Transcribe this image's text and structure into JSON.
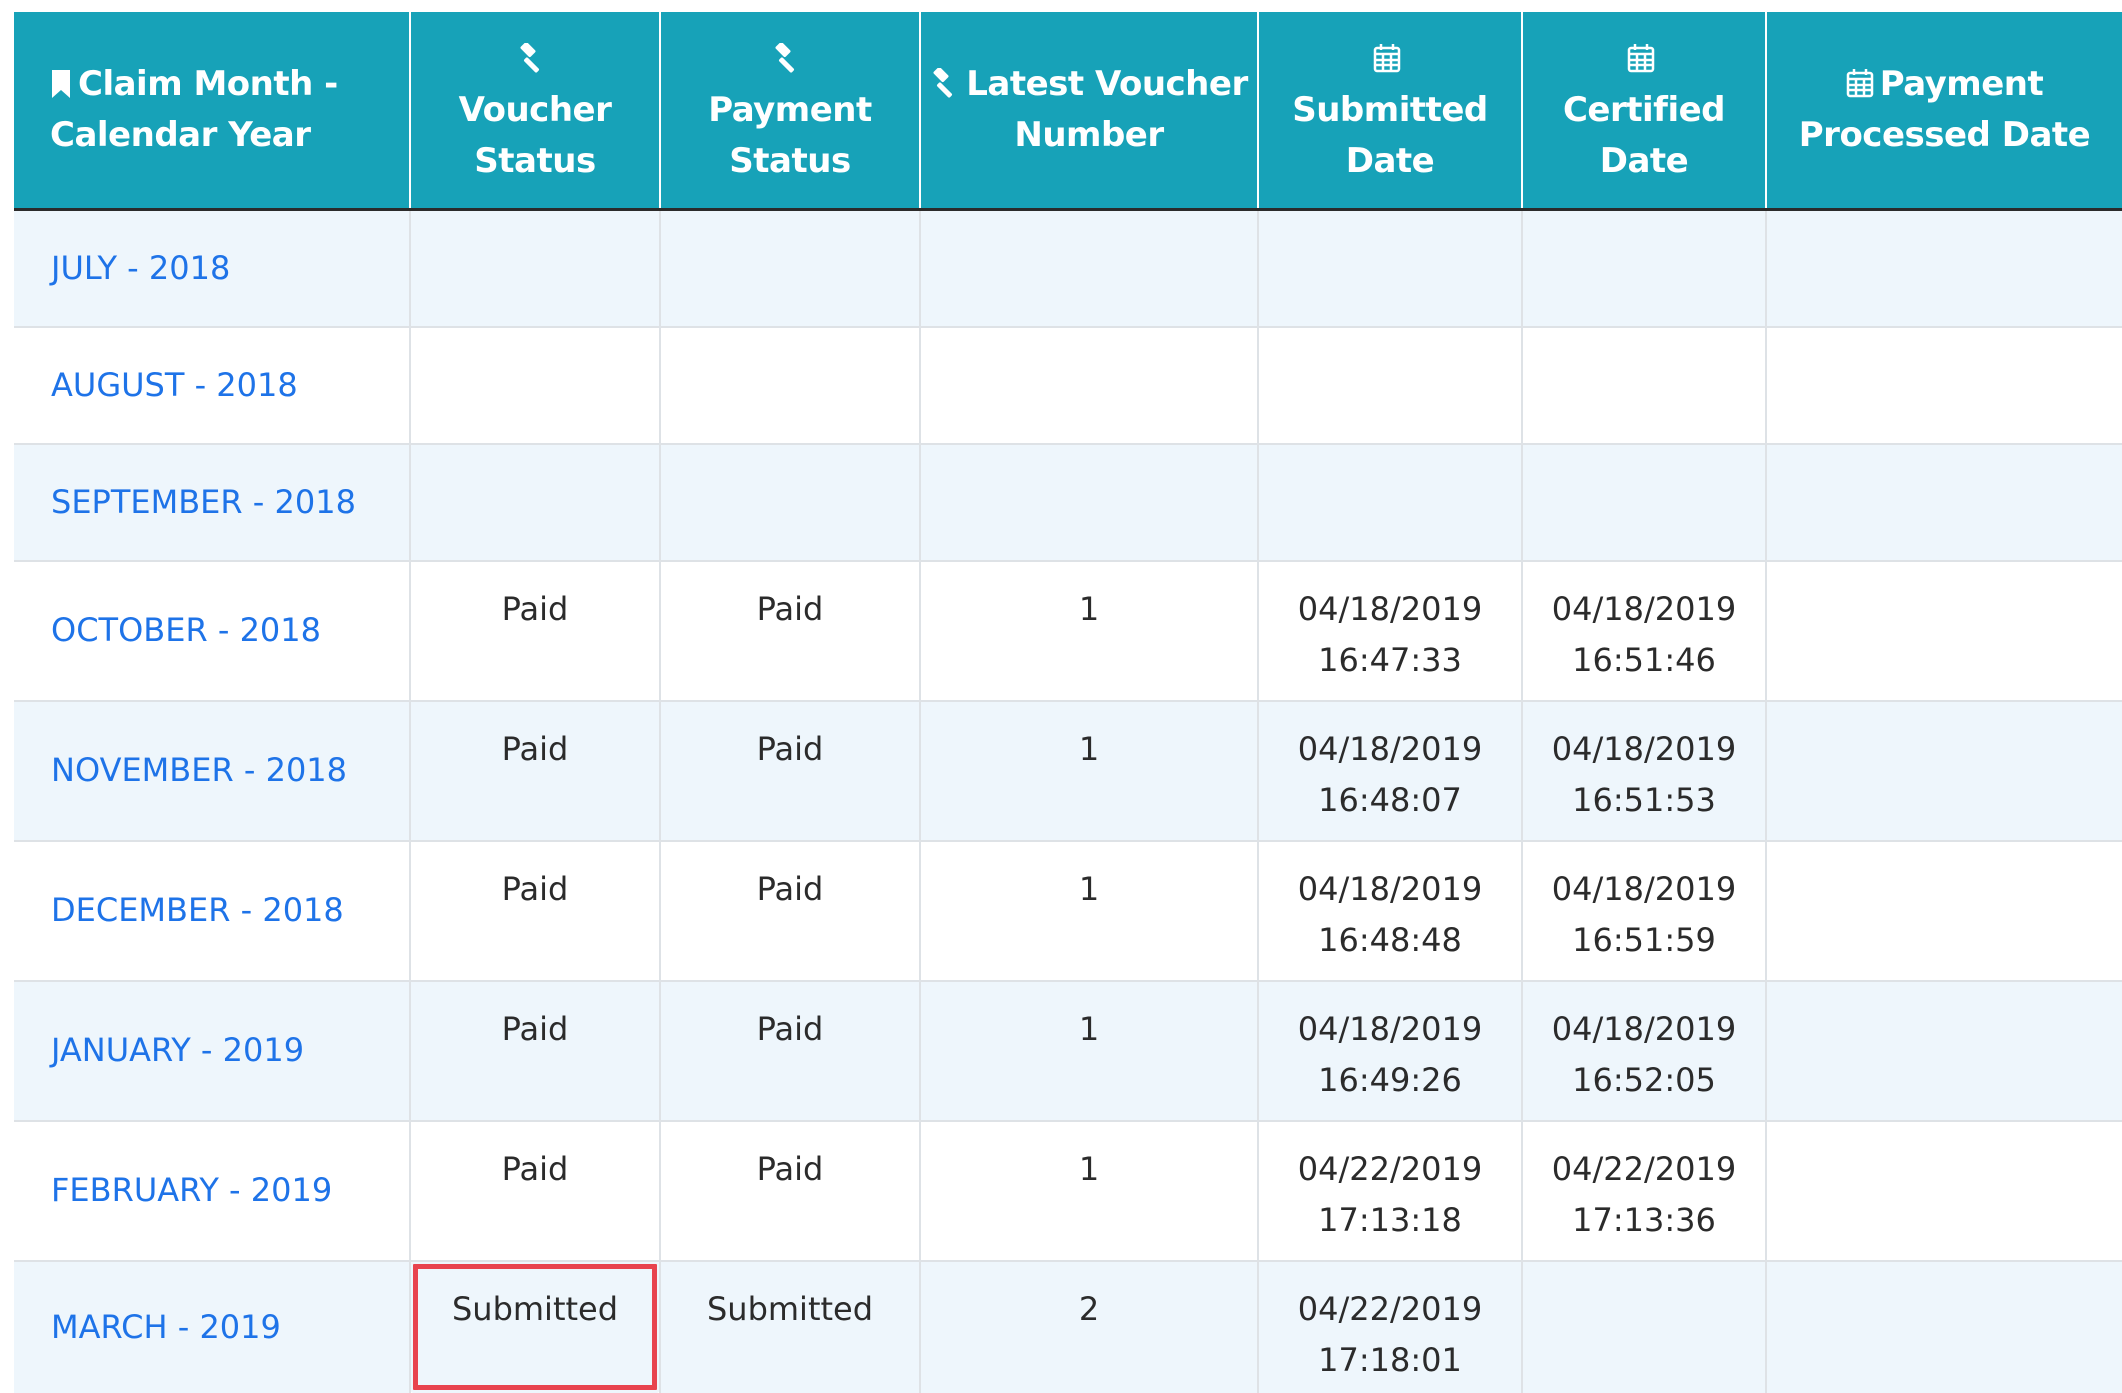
{
  "table": {
    "headers": [
      {
        "icon": "bookmark-icon",
        "label": "Claim Month - Calendar Year"
      },
      {
        "icon": "gavel-icon",
        "label": "Voucher Status"
      },
      {
        "icon": "gavel-icon",
        "label": "Payment Status"
      },
      {
        "icon": "gavel-icon",
        "label": "Latest Voucher Number"
      },
      {
        "icon": "calendar-icon",
        "label": "Submitted Date"
      },
      {
        "icon": "calendar-icon",
        "label": "Certified Date"
      },
      {
        "icon": "calendar-icon",
        "label": "Payment Processed Date"
      }
    ],
    "rows": [
      {
        "month": "JULY - 2018",
        "voucher_status": "",
        "payment_status": "",
        "voucher_number": "",
        "submitted_date": "",
        "submitted_time": "",
        "certified_date": "",
        "certified_time": "",
        "processed_date": ""
      },
      {
        "month": "AUGUST - 2018",
        "voucher_status": "",
        "payment_status": "",
        "voucher_number": "",
        "submitted_date": "",
        "submitted_time": "",
        "certified_date": "",
        "certified_time": "",
        "processed_date": ""
      },
      {
        "month": "SEPTEMBER - 2018",
        "voucher_status": "",
        "payment_status": "",
        "voucher_number": "",
        "submitted_date": "",
        "submitted_time": "",
        "certified_date": "",
        "certified_time": "",
        "processed_date": ""
      },
      {
        "month": "OCTOBER - 2018",
        "voucher_status": "Paid",
        "payment_status": "Paid",
        "voucher_number": "1",
        "submitted_date": "04/18/2019",
        "submitted_time": "16:47:33",
        "certified_date": "04/18/2019",
        "certified_time": "16:51:46",
        "processed_date": ""
      },
      {
        "month": "NOVEMBER - 2018",
        "voucher_status": "Paid",
        "payment_status": "Paid",
        "voucher_number": "1",
        "submitted_date": "04/18/2019",
        "submitted_time": "16:48:07",
        "certified_date": "04/18/2019",
        "certified_time": "16:51:53",
        "processed_date": ""
      },
      {
        "month": "DECEMBER - 2018",
        "voucher_status": "Paid",
        "payment_status": "Paid",
        "voucher_number": "1",
        "submitted_date": "04/18/2019",
        "submitted_time": "16:48:48",
        "certified_date": "04/18/2019",
        "certified_time": "16:51:59",
        "processed_date": ""
      },
      {
        "month": "JANUARY - 2019",
        "voucher_status": "Paid",
        "payment_status": "Paid",
        "voucher_number": "1",
        "submitted_date": "04/18/2019",
        "submitted_time": "16:49:26",
        "certified_date": "04/18/2019",
        "certified_time": "16:52:05",
        "processed_date": ""
      },
      {
        "month": "FEBRUARY - 2019",
        "voucher_status": "Paid",
        "payment_status": "Paid",
        "voucher_number": "1",
        "submitted_date": "04/22/2019",
        "submitted_time": "17:13:18",
        "certified_date": "04/22/2019",
        "certified_time": "17:13:36",
        "processed_date": ""
      },
      {
        "month": "MARCH - 2019",
        "voucher_status": "Submitted",
        "payment_status": "Submitted",
        "voucher_number": "2",
        "submitted_date": "04/22/2019",
        "submitted_time": "17:18:01",
        "certified_date": "",
        "certified_time": "",
        "processed_date": ""
      }
    ]
  },
  "colors": {
    "header_bg": "#17a2b8",
    "header_text": "#ffffff",
    "link": "#1e73e8",
    "stripe": "#eef6fc",
    "highlight": "#e8434e"
  }
}
